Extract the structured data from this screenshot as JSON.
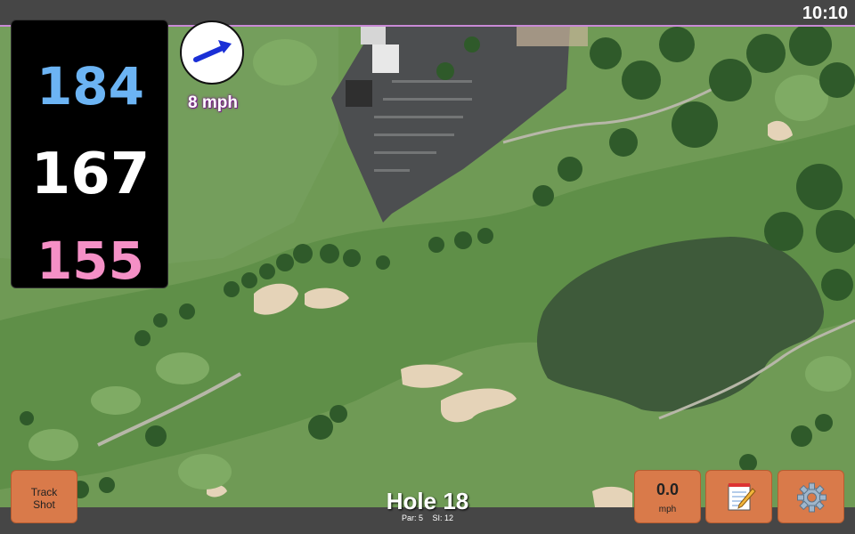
{
  "status": {
    "time": "10:10"
  },
  "distances": {
    "back": "184",
    "middle": "167",
    "front": "155"
  },
  "wind": {
    "speed": "8 mph",
    "arrow_icon": "wind-arrow-icon"
  },
  "hole": {
    "title": "Hole 18",
    "par": "Par: 5",
    "si": "SI: 12"
  },
  "buttons": {
    "track_shot_line1": "Track",
    "track_shot_line2": "Shot",
    "speed_value": "0.0",
    "speed_unit": "mph",
    "notes_icon": "notepad-icon",
    "settings_icon": "gear-icon"
  },
  "colors": {
    "back_distance": "#6cb4f4",
    "middle_distance": "#ffffff",
    "front_distance": "#f590c6",
    "button": "#d97a4a",
    "wind_arrow": "#1a2fd6"
  }
}
